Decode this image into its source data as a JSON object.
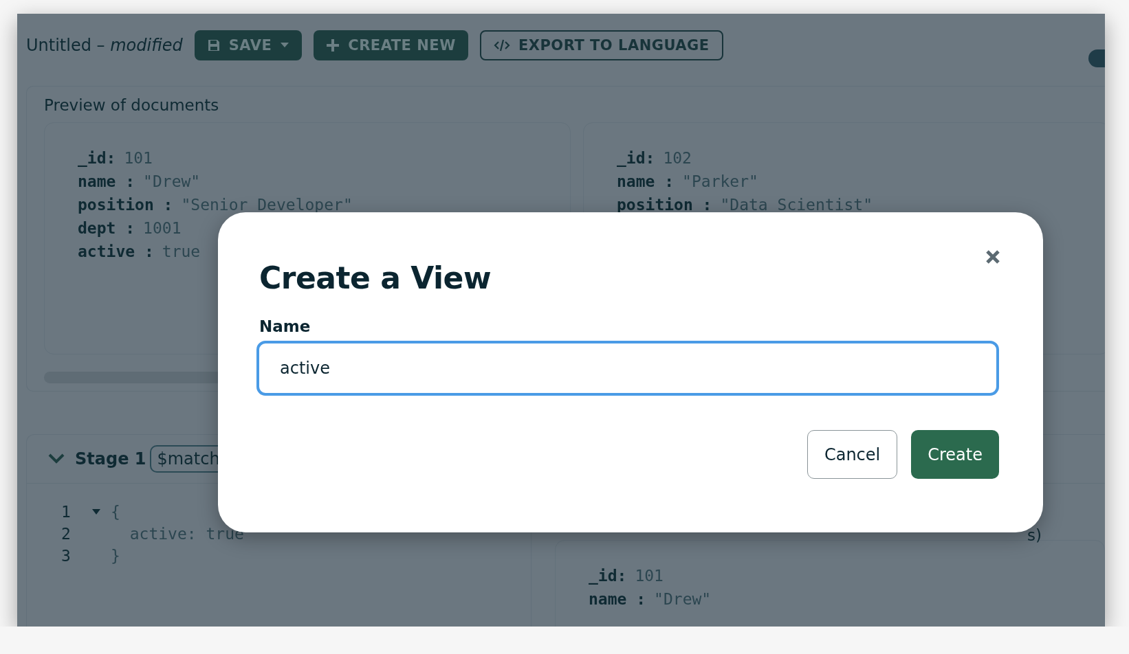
{
  "toolbar": {
    "title": "Untitled",
    "separator": "–",
    "status": "modified",
    "buttons": [
      {
        "kind": "filled",
        "label": "SAVE",
        "dropdown": true
      },
      {
        "kind": "filled",
        "label": "CREATE NEW",
        "dropdown": false
      },
      {
        "kind": "outline",
        "label": "EXPORT TO LANGUAGE",
        "dropdown": false
      }
    ],
    "toggle": {
      "on": true
    }
  },
  "preview": {
    "title": "Preview of documents",
    "documents": [
      {
        "fields": [
          {
            "key": "_id:",
            "value": "101"
          },
          {
            "key": "name :",
            "value": "\"Drew\""
          },
          {
            "key": "position :",
            "value": "\"Senior Developer\""
          },
          {
            "key": "dept :",
            "value": "1001"
          },
          {
            "key": "active :",
            "value": "true"
          }
        ]
      },
      {
        "fields": [
          {
            "key": "_id:",
            "value": "102"
          },
          {
            "key": "name :",
            "value": "\"Parker\""
          },
          {
            "key": "position :",
            "value": "\"Data Scientist\""
          }
        ]
      }
    ]
  },
  "stage": {
    "title": "Stage 1",
    "operator": "$match",
    "expanded": true,
    "code": [
      {
        "number": "1",
        "fold": true,
        "text": "{"
      },
      {
        "number": "2",
        "fold": false,
        "text": "  active: true"
      },
      {
        "number": "3",
        "fold": false,
        "text": "}"
      }
    ],
    "results": {
      "note": "s)",
      "documents": [
        {
          "fields": [
            {
              "key": "_id:",
              "value": "101"
            },
            {
              "key": "name :",
              "value": "\"Drew\""
            }
          ]
        }
      ]
    }
  },
  "modal": {
    "title": "Create a View",
    "field": {
      "label": "Name",
      "value": "active",
      "focused": true
    },
    "buttons": [
      {
        "kind": "secondary",
        "label": "Cancel"
      },
      {
        "kind": "primary",
        "label": "Create"
      }
    ]
  }
}
